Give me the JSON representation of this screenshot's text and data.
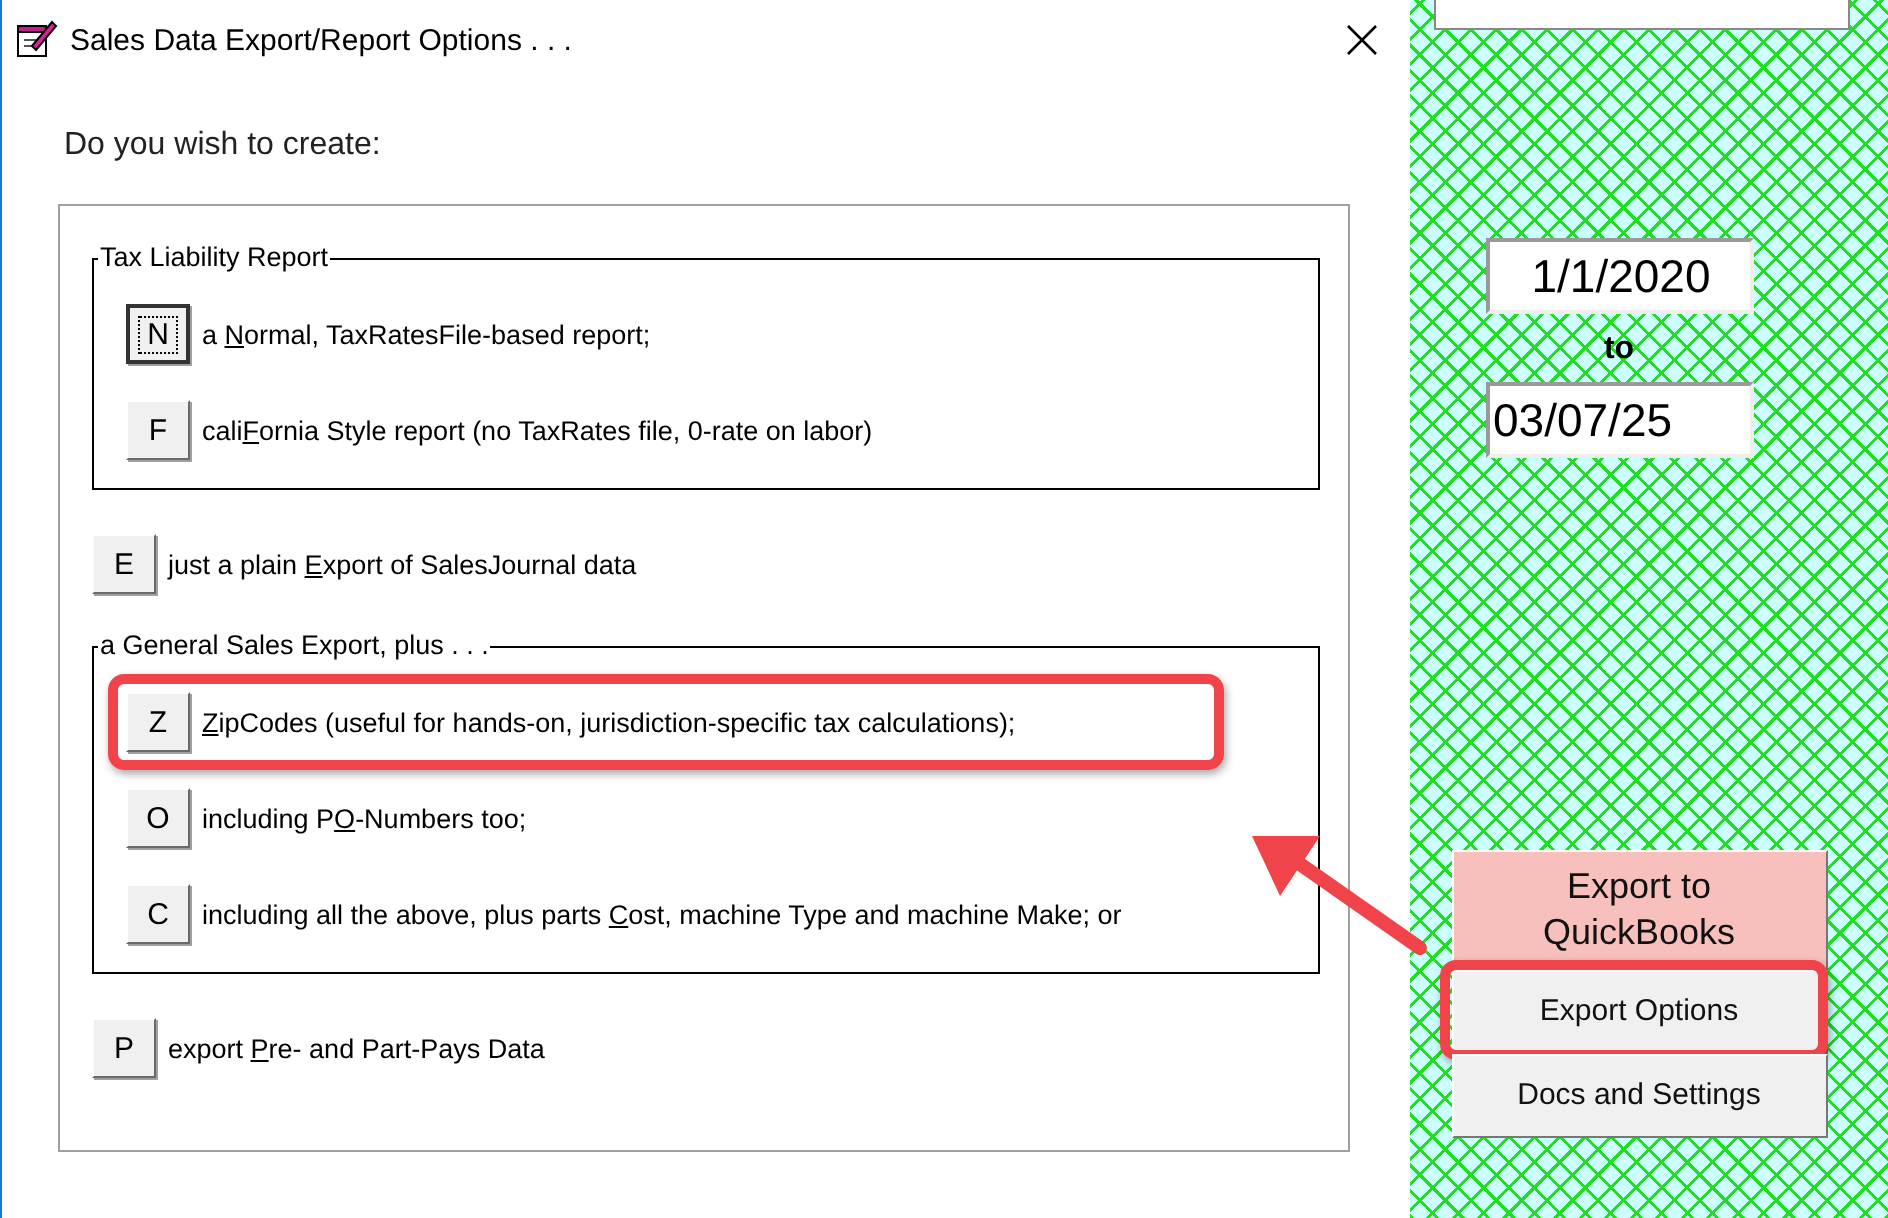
{
  "window": {
    "title": "Sales Data Export/Report Options . . ."
  },
  "prompt": "Do you wish to create:",
  "sections": [
    {
      "kind": "group",
      "title": "Tax Liability Report",
      "options": [
        {
          "key": "N",
          "label_parts": [
            "a ",
            "N",
            "ormal, TaxRatesFile-based report;"
          ],
          "focused": true,
          "highlighted": false
        },
        {
          "key": "F",
          "label_parts": [
            "cali",
            "F",
            "ornia Style report (no TaxRates file, 0-rate on labor)"
          ],
          "focused": false,
          "highlighted": false
        }
      ]
    },
    {
      "kind": "single",
      "options": [
        {
          "key": "E",
          "label_parts": [
            "just a plain ",
            "E",
            "xport of SalesJournal data"
          ],
          "focused": false,
          "highlighted": false
        }
      ]
    },
    {
      "kind": "group",
      "title": "a General Sales Export, plus . . .",
      "options": [
        {
          "key": "Z",
          "label_parts": [
            "Z",
            "ipCodes (useful for hands-on, jurisdiction-specific tax calculations);"
          ],
          "focused": false,
          "highlighted": true
        },
        {
          "key": "O",
          "label_parts": [
            "including P",
            "O",
            "-Numbers too;"
          ],
          "focused": false,
          "highlighted": false
        },
        {
          "key": "C",
          "label_parts": [
            "including all the above, plus parts ",
            "C",
            "ost, machine Type and machine Make; or"
          ],
          "focused": false,
          "highlighted": false
        }
      ]
    },
    {
      "kind": "single",
      "options": [
        {
          "key": "P",
          "label_parts": [
            "export ",
            "P",
            "re- and Part-Pays Data"
          ],
          "focused": false,
          "highlighted": false
        }
      ]
    }
  ],
  "side_panel": {
    "date_from": "1/1/2020",
    "separator": "to",
    "date_to": "03/07/25",
    "buttons": [
      {
        "label": "Export to QuickBooks",
        "color": "#f8c0bc",
        "highlighted": false
      },
      {
        "label": "Export Options",
        "color": "#f0f0f0",
        "highlighted": true
      },
      {
        "label": "Docs and Settings",
        "color": "#f0f0f0",
        "highlighted": false
      }
    ]
  },
  "annotation_arrow": true
}
